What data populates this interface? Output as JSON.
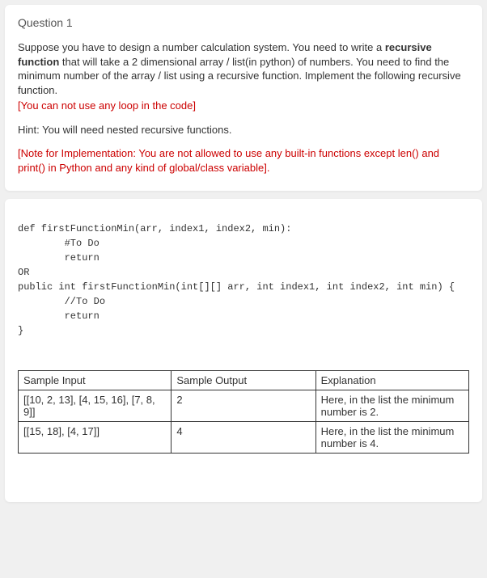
{
  "question": {
    "title": "Question 1",
    "body_line1": "Suppose you have to design a number calculation system. You need to write a ",
    "body_bold": "recursive function",
    "body_line2": " that will take a 2 dimensional array / list(in python) of numbers. You need to find the minimum number of the array / list using a recursive function. Implement the following recursive function.",
    "restriction": "[You can not use any loop in the code]",
    "hint": "Hint: You will need nested recursive functions.",
    "note": "[Note for Implementation: You are not allowed to use any built-in functions except len() and print() in Python and any kind of global/class variable]."
  },
  "code": {
    "py_def": "def firstFunctionMin(arr, index1, index2, min):",
    "py_todo": "        #To Do",
    "py_return": "        return",
    "or_label": "OR",
    "java_def": "public int firstFunctionMin(int[][] arr, int index1, int index2, int min) {",
    "java_todo": "        //To Do",
    "java_return": "        return",
    "java_close": "}"
  },
  "table": {
    "headers": {
      "c1": "Sample Input",
      "c2": "Sample Output",
      "c3": "Explanation"
    },
    "rows": [
      {
        "input": "[[10, 2, 13], [4, 15, 16], [7, 8, 9]]",
        "output": "2",
        "explanation": "Here, in the list the minimum number is 2."
      },
      {
        "input": "[[15, 18], [4, 17]]",
        "output": "4",
        "explanation": "Here, in the list the minimum number is 4."
      }
    ]
  }
}
